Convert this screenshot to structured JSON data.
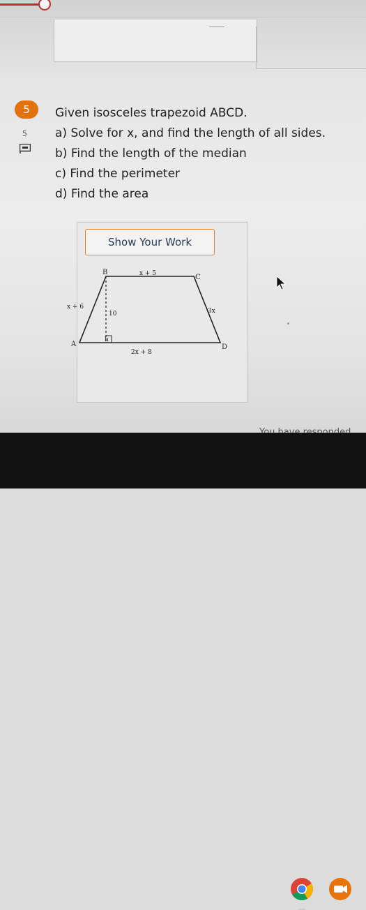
{
  "question": {
    "number": "5",
    "points": "5",
    "lines": [
      "Given isosceles trapezoid ABCD.",
      "a) Solve for x, and find the length of all sides.",
      "b) Find the length of the median",
      "c) Find the perimeter",
      "d) Find the area"
    ]
  },
  "show_work_label": "Show Your Work",
  "diagram": {
    "vertex_labels": {
      "a": "A",
      "b": "B",
      "c": "C",
      "d": "D",
      "h": "h"
    },
    "side_labels": {
      "top": "x + 5",
      "left": "x + 6",
      "right": "3x",
      "bottom": "2x + 8",
      "height": "10"
    }
  },
  "status": {
    "responded": "You have responded"
  },
  "colors": {
    "accent": "#e2720f",
    "slider": "#b5302a"
  },
  "icons": [
    "flag-icon",
    "cursor-icon",
    "chrome-icon",
    "meet-icon"
  ]
}
